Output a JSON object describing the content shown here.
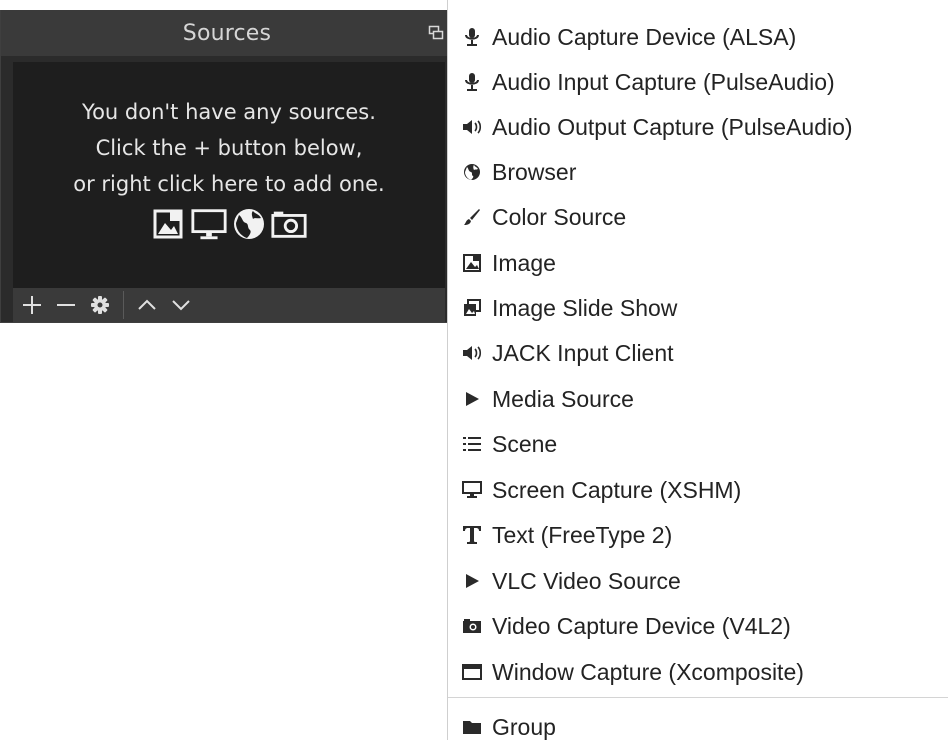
{
  "sources_dock": {
    "title": "Sources",
    "empty_message": {
      "line1": "You don't have any sources.",
      "line2": "Click the + button below,",
      "line3": "or right click here to add one."
    },
    "placeholder_icons": [
      "image-icon",
      "monitor-icon",
      "globe-icon",
      "camera-icon"
    ],
    "toolbar": {
      "add": "+",
      "remove": "−",
      "properties": "gear-icon",
      "move_up": "chevron-up-icon",
      "move_down": "chevron-down-icon"
    }
  },
  "add_source_menu": {
    "items": [
      {
        "label": "Audio Capture Device (ALSA)",
        "icon": "microphone-icon"
      },
      {
        "label": "Audio Input Capture (PulseAudio)",
        "icon": "microphone-icon"
      },
      {
        "label": "Audio Output Capture (PulseAudio)",
        "icon": "speaker-icon"
      },
      {
        "label": "Browser",
        "icon": "globe-icon"
      },
      {
        "label": "Color Source",
        "icon": "brush-icon"
      },
      {
        "label": "Image",
        "icon": "image-icon"
      },
      {
        "label": "Image Slide Show",
        "icon": "slideshow-icon"
      },
      {
        "label": "JACK Input Client",
        "icon": "speaker-icon"
      },
      {
        "label": "Media Source",
        "icon": "play-icon"
      },
      {
        "label": "Scene",
        "icon": "list-icon"
      },
      {
        "label": "Screen Capture (XSHM)",
        "icon": "monitor-icon"
      },
      {
        "label": "Text (FreeType 2)",
        "icon": "text-icon"
      },
      {
        "label": "VLC Video Source",
        "icon": "play-icon"
      },
      {
        "label": "Video Capture Device (V4L2)",
        "icon": "camera-icon"
      },
      {
        "label": "Window Capture (Xcomposite)",
        "icon": "window-icon"
      },
      {
        "label": "Group",
        "icon": "folder-icon"
      }
    ]
  }
}
